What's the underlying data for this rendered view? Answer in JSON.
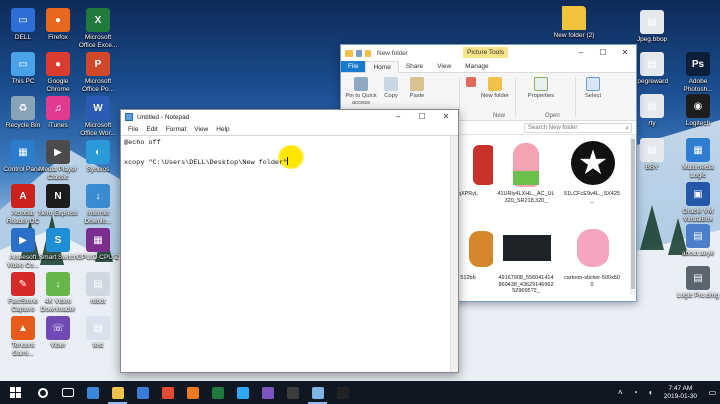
{
  "desktop": {
    "icons_left": [
      {
        "label": "DELL",
        "color": "#2d6fd6",
        "glyph": "▭"
      },
      {
        "label": "Firefox",
        "color": "#e8671c",
        "glyph": "●"
      },
      {
        "label": "Microsoft Office Exce...",
        "color": "#1f7a3c",
        "glyph": "X"
      },
      {
        "label": "This PC",
        "color": "#4aa3e8",
        "glyph": "▭"
      },
      {
        "label": "Google Chrome",
        "color": "#dc3b2f",
        "glyph": "●"
      },
      {
        "label": "Microsoft Office Po...",
        "color": "#d0482a",
        "glyph": "P"
      },
      {
        "label": "Recycle Bin",
        "color": "#8aa2b8",
        "glyph": "♻"
      },
      {
        "label": "iTunes",
        "color": "#e03b8e",
        "glyph": "♫"
      },
      {
        "label": "Microsoft Office Wor...",
        "color": "#2b5bb4",
        "glyph": "W"
      },
      {
        "label": "Control Panel",
        "color": "#2a7ccc",
        "glyph": "▦"
      },
      {
        "label": "Media Player Classic",
        "color": "#4b4b4b",
        "glyph": "▶"
      },
      {
        "label": "Syncios",
        "color": "#2a9ad8",
        "glyph": "◐"
      },
      {
        "label": "Acrobat Reader DC",
        "color": "#c9231b",
        "glyph": "A"
      },
      {
        "label": "Nero Express",
        "color": "#1c1c1c",
        "glyph": "N"
      },
      {
        "label": "Internet Downlo...",
        "color": "#3a8bd0",
        "glyph": "↓"
      },
      {
        "label": "Aiseesoft Video Co...",
        "color": "#2a70c8",
        "glyph": "▶"
      },
      {
        "label": "Smart Switch",
        "color": "#1e8fd6",
        "glyph": "S"
      },
      {
        "label": "GPUID CPU-Z",
        "color": "#7c2e8f",
        "glyph": "▦"
      },
      {
        "label": "FastStone Capture",
        "color": "#d42a2a",
        "glyph": "✎"
      },
      {
        "label": "4K Video Downloader",
        "color": "#67b64a",
        "glyph": "↓"
      },
      {
        "label": "robot",
        "color": "#cfd8e2",
        "glyph": "▤"
      },
      {
        "label": "Tencent Gami...",
        "color": "#e65b1a",
        "glyph": "▲"
      },
      {
        "label": "Viber",
        "color": "#6f4ab5",
        "glyph": "☏"
      },
      {
        "label": "test",
        "color": "#d9e2ec",
        "glyph": "▤"
      }
    ],
    "icons_right": [
      {
        "label": "New folder (2)",
        "color": "#f0c33d",
        "glyph": ""
      },
      {
        "label": "Jpeg.bbop",
        "color": "#e5e9ee",
        "glyph": "▤"
      },
      {
        "label": "Adobe Photosh...",
        "color": "#0c1f3a",
        "glyph": "Ps"
      },
      {
        "label": "jpegreward",
        "color": "#e5e9ee",
        "glyph": "▤"
      },
      {
        "label": "Logitech",
        "color": "#1d1d1d",
        "glyph": "◉"
      },
      {
        "label": "rty",
        "color": "#e5e9ee",
        "glyph": "▤"
      },
      {
        "label": "Multimedia Logic",
        "color": "#2e7dd3",
        "glyph": "▦"
      },
      {
        "label": "BBY",
        "color": "#e5e9ee",
        "glyph": "▤"
      },
      {
        "label": "Oracle VM VirtualBox",
        "color": "#2457a8",
        "glyph": "▣"
      },
      {
        "label": "about.aeye",
        "color": "#4b7fc9",
        "glyph": "▤"
      },
      {
        "label": "Logic Pro.dmg",
        "color": "#5b6570",
        "glyph": "▤"
      }
    ]
  },
  "explorer": {
    "title": "New folder",
    "context_tab": "Picture Tools",
    "window_buttons": [
      "–",
      "☐",
      "✕"
    ],
    "tabs": [
      "File",
      "Home",
      "Share",
      "View",
      "Manage"
    ],
    "ribbon": {
      "pin_label": "Pin to Quick access",
      "copy_label": "Copy",
      "paste_label": "Paste",
      "new_folder_label": "New folder",
      "properties_label": "Properties",
      "select_label": "Select",
      "groups": [
        "New",
        "Open"
      ]
    },
    "search_placeholder": "Search New folder",
    "files": [
      {
        "name": "qXPRyL",
        "kind": "partial-red"
      },
      {
        "name": "41URiy4LXHL._AC_UL320_SR218,320_",
        "kind": "patrick"
      },
      {
        "name": "51LCFcE9v4L._SX425_",
        "kind": "star"
      },
      {
        "name": "512bb",
        "kind": "partial-orange"
      },
      {
        "name": "49167908_556041414860438_43629146962529695?2_",
        "kind": "dark"
      },
      {
        "name": "cartoon-sticker-500x500",
        "kind": "panther"
      }
    ]
  },
  "notepad": {
    "title": "Untitled - Notepad",
    "window_buttons": [
      "–",
      "☐",
      "✕"
    ],
    "menu": [
      "File",
      "Edit",
      "Format",
      "View",
      "Help"
    ],
    "lines": [
      "@echo off",
      "",
      "xcopy \"C:\\Users\\DELL\\Desktop\\New folder\""
    ]
  },
  "taskbar": {
    "time": "7:47 AM",
    "date": "2019-01-30",
    "apps": [
      {
        "name": "cortana",
        "color": "#ffffff"
      },
      {
        "name": "task-view",
        "color": "#ffffff"
      },
      {
        "name": "edge",
        "color": "#3a87d9"
      },
      {
        "name": "file-explorer",
        "color": "#f2c14a"
      },
      {
        "name": "store",
        "color": "#3a7bd5"
      },
      {
        "name": "chrome",
        "color": "#e44c35"
      },
      {
        "name": "firefox",
        "color": "#ef7a1f"
      },
      {
        "name": "excel",
        "color": "#1f7a3c"
      },
      {
        "name": "photoshop",
        "color": "#31a8ff"
      },
      {
        "name": "viber",
        "color": "#7d56c2"
      },
      {
        "name": "app-78",
        "color": "#3c3c3c"
      },
      {
        "name": "notepad",
        "color": "#7fb4e6"
      },
      {
        "name": "cmd",
        "color": "#222222"
      }
    ]
  }
}
